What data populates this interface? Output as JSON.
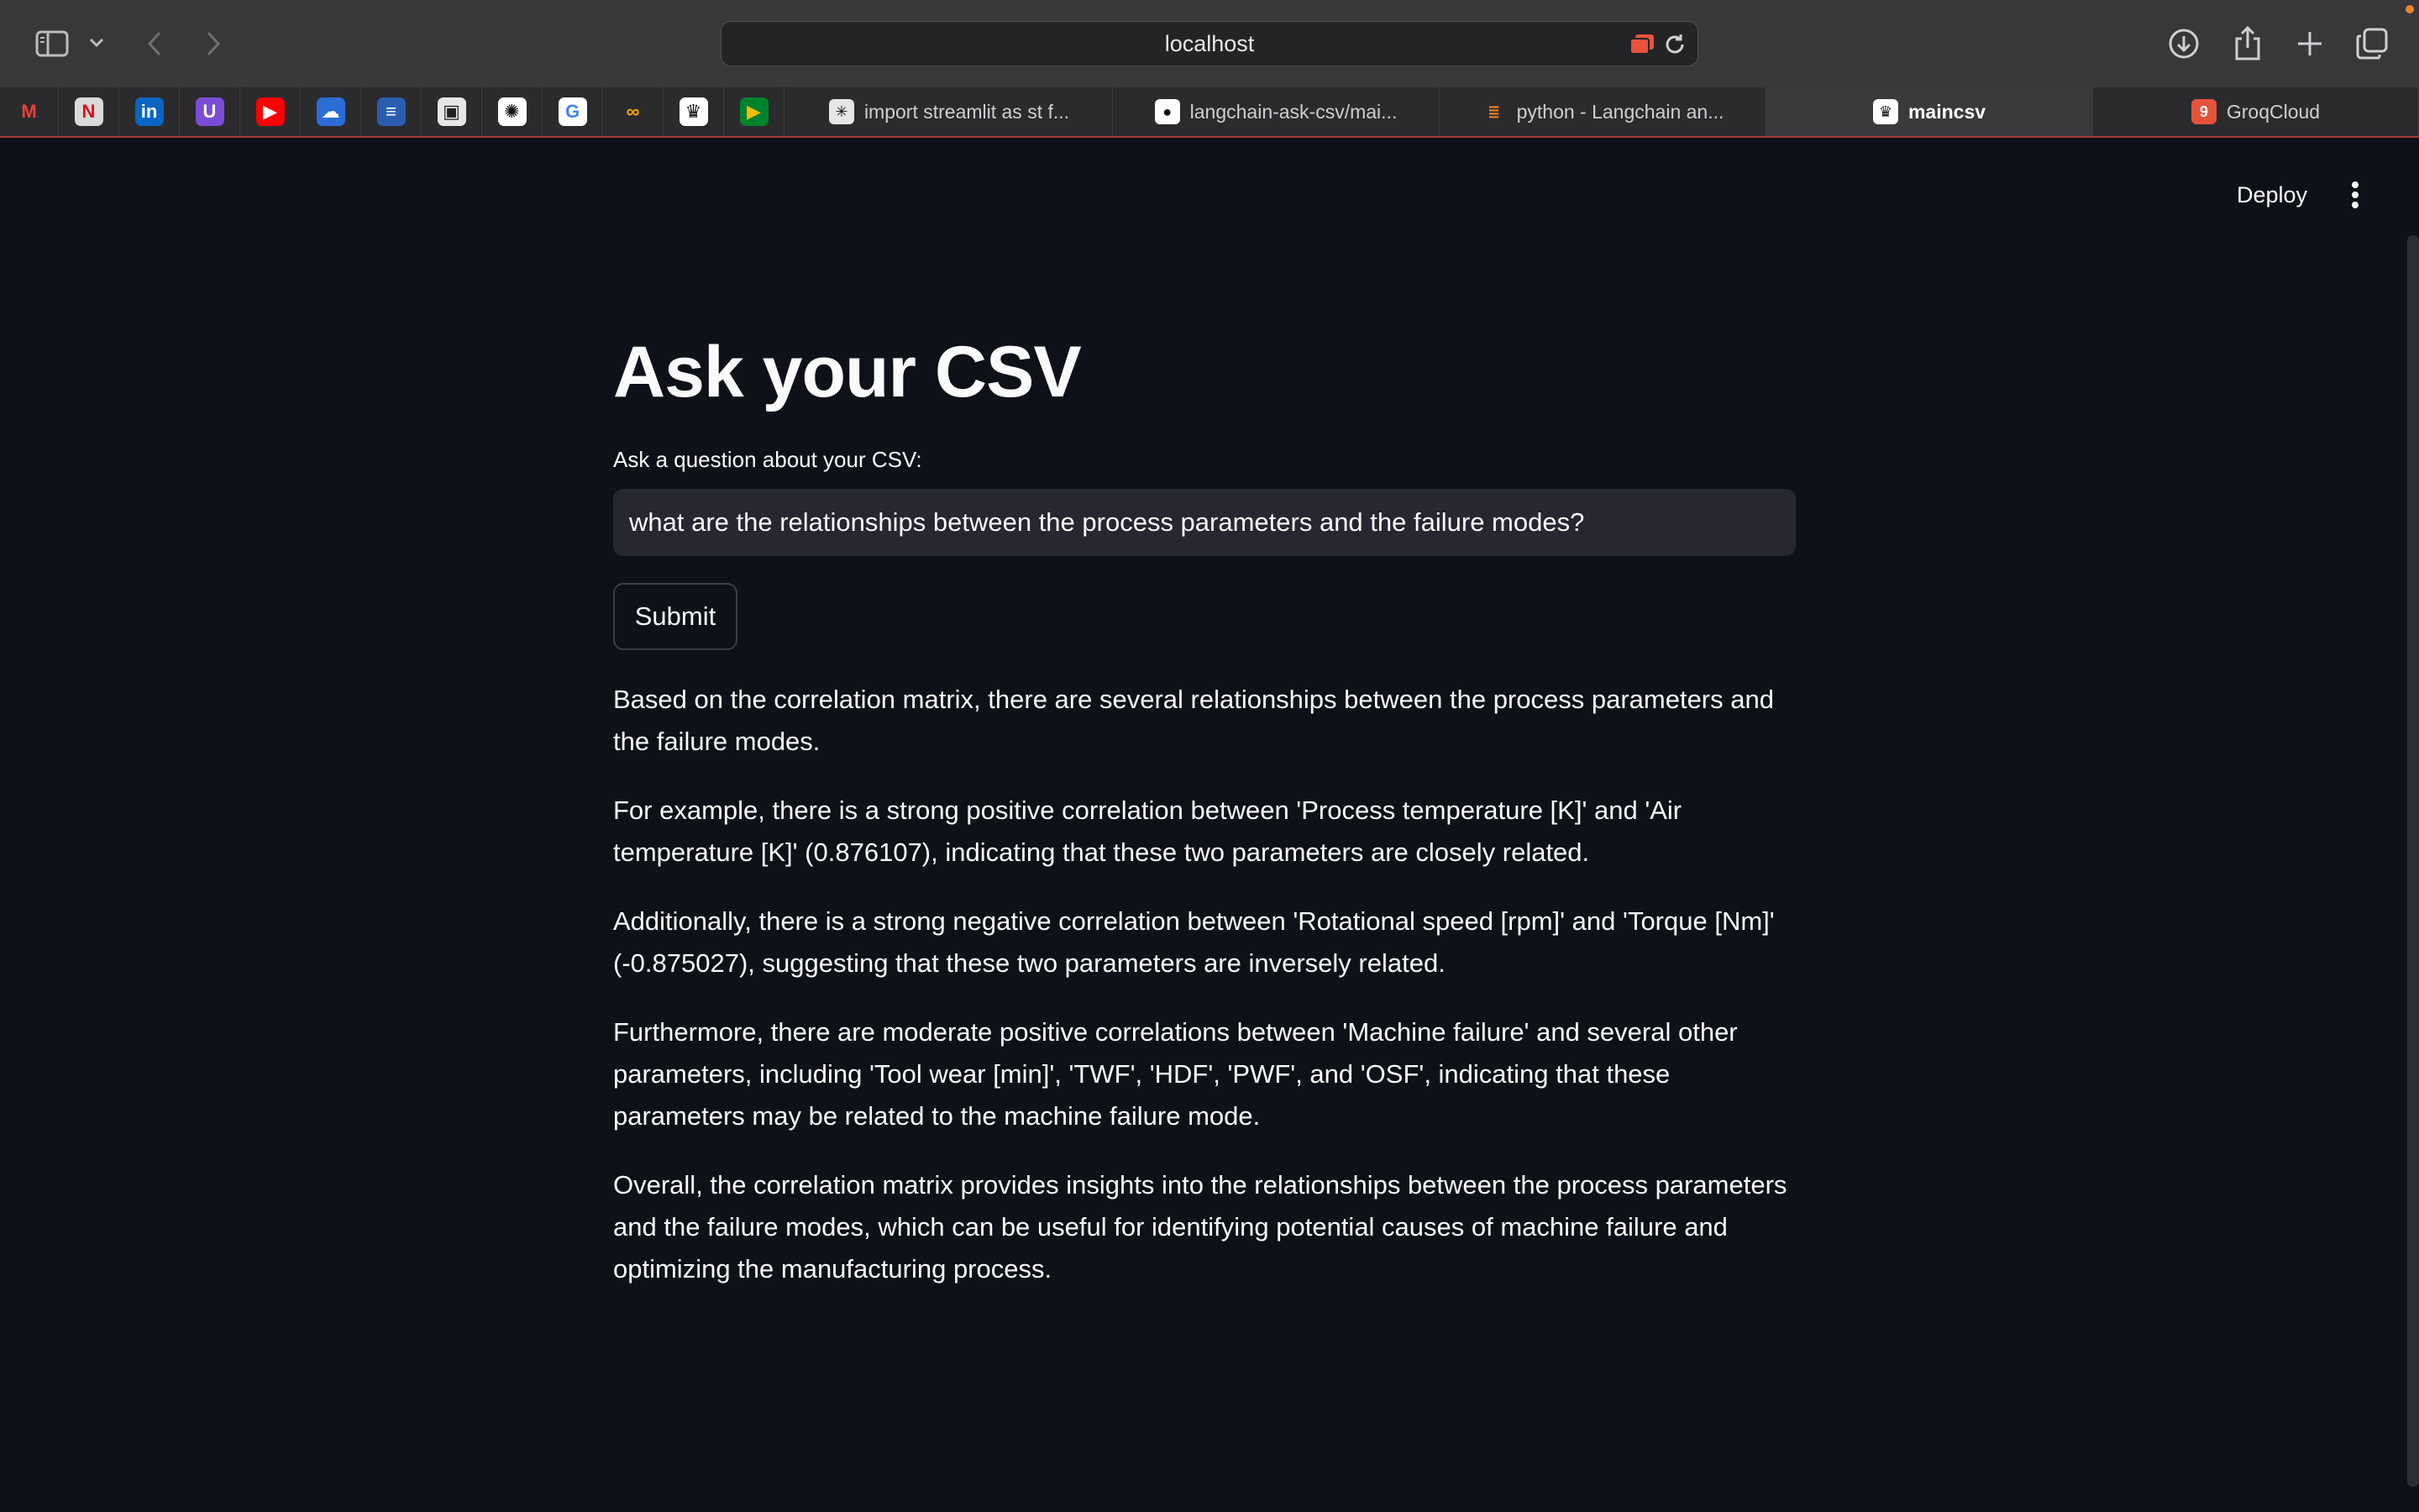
{
  "browser": {
    "url": "localhost",
    "pinned_tabs": [
      {
        "icon": "gmail-icon",
        "glyph": "M",
        "color": "#2b2b2d",
        "fg": "#e94235"
      },
      {
        "icon": "netflix-icon",
        "glyph": "N",
        "color": "#d9d9d9",
        "fg": "#e50914"
      },
      {
        "icon": "linkedin-icon",
        "glyph": "in",
        "color": "#0a66c2",
        "fg": "#ffffff"
      },
      {
        "icon": "proton-icon",
        "glyph": "U",
        "color": "#7b4dd6",
        "fg": "#ffffff"
      },
      {
        "icon": "youtube-icon",
        "glyph": "▶",
        "color": "#ff0000",
        "fg": "#ffffff"
      },
      {
        "icon": "onedrive-icon",
        "glyph": "☁",
        "color": "#2b6cd6",
        "fg": "#ffffff"
      },
      {
        "icon": "docs-icon",
        "glyph": "≡",
        "color": "#2a5db0",
        "fg": "#ffffff"
      },
      {
        "icon": "media-icon",
        "glyph": "▣",
        "color": "#e6e6e6",
        "fg": "#222222"
      },
      {
        "icon": "openai-icon",
        "glyph": "✺",
        "color": "#ffffff",
        "fg": "#111111"
      },
      {
        "icon": "google-icon",
        "glyph": "G",
        "color": "#ffffff",
        "fg": "#4285f4"
      },
      {
        "icon": "colab-icon",
        "glyph": "∞",
        "color": "#2b2b2d",
        "fg": "#f9ab00"
      },
      {
        "icon": "streamlit-icon",
        "glyph": "♛",
        "color": "#ffffff",
        "fg": "#111111"
      },
      {
        "icon": "meet-icon",
        "glyph": "▶",
        "color": "#00832d",
        "fg": "#fbbc04"
      }
    ],
    "tabs": [
      {
        "label": "import streamlit as st f...",
        "icon": "perplexity-icon",
        "glyph": "✳",
        "color": "#e6e6e6",
        "fg": "#111111",
        "active": false
      },
      {
        "label": "langchain-ask-csv/mai...",
        "icon": "github-icon",
        "glyph": "●",
        "color": "#ffffff",
        "fg": "#111111",
        "active": false
      },
      {
        "label": "python - Langchain an...",
        "icon": "stackoverflow-icon",
        "glyph": "≣",
        "color": "#2b2b2d",
        "fg": "#f48024",
        "active": false
      },
      {
        "label": "maincsv",
        "icon": "streamlit-icon",
        "glyph": "♛",
        "color": "#ffffff",
        "fg": "#111111",
        "active": true
      },
      {
        "label": "GroqCloud",
        "icon": "groq-icon",
        "glyph": "9",
        "color": "#e5533d",
        "fg": "#ffffff",
        "active": false
      }
    ]
  },
  "header": {
    "deploy_label": "Deploy"
  },
  "main": {
    "title": "Ask your CSV",
    "question_label": "Ask a question about your CSV:",
    "question_value": "what are the relationships between the process parameters and the failure modes?",
    "submit_label": "Submit",
    "answer_paragraphs": [
      "Based on the correlation matrix, there are several relationships between the process parameters and the failure modes.",
      "For example, there is a strong positive correlation between 'Process temperature [K]' and 'Air temperature [K]' (0.876107), indicating that these two parameters are closely related.",
      "Additionally, there is a strong negative correlation between 'Rotational speed [rpm]' and 'Torque [Nm]' (-0.875027), suggesting that these two parameters are inversely related.",
      "Furthermore, there are moderate positive correlations between 'Machine failure' and several other parameters, including 'Tool wear [min]', 'TWF', 'HDF', 'PWF', and 'OSF', indicating that these parameters may be related to the machine failure mode.",
      "Overall, the correlation matrix provides insights into the relationships between the process parameters and the failure modes, which can be useful for identifying potential causes of machine failure and optimizing the manufacturing process."
    ]
  }
}
